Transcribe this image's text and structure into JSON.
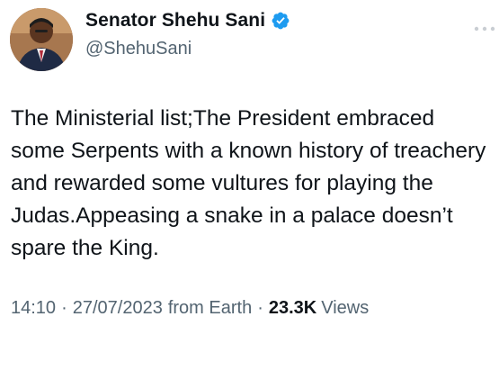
{
  "author": {
    "display_name": "Senator Shehu Sani",
    "handle": "@ShehuSani",
    "verified": true,
    "verified_color": "#1d9bf0"
  },
  "tweet": {
    "text": "The Ministerial list;The President embraced some Serpents with a known history of treachery and rewarded some vultures for playing the Judas.Appeasing a snake in a palace doesn’t spare the King.",
    "time": "14:10",
    "separator": "·",
    "date": "27/07/2023",
    "source": "from Earth",
    "views_count": "23.3K",
    "views_label": "Views"
  },
  "icons": {
    "verified": "verified-badge-icon",
    "more": "more-options-icon"
  }
}
